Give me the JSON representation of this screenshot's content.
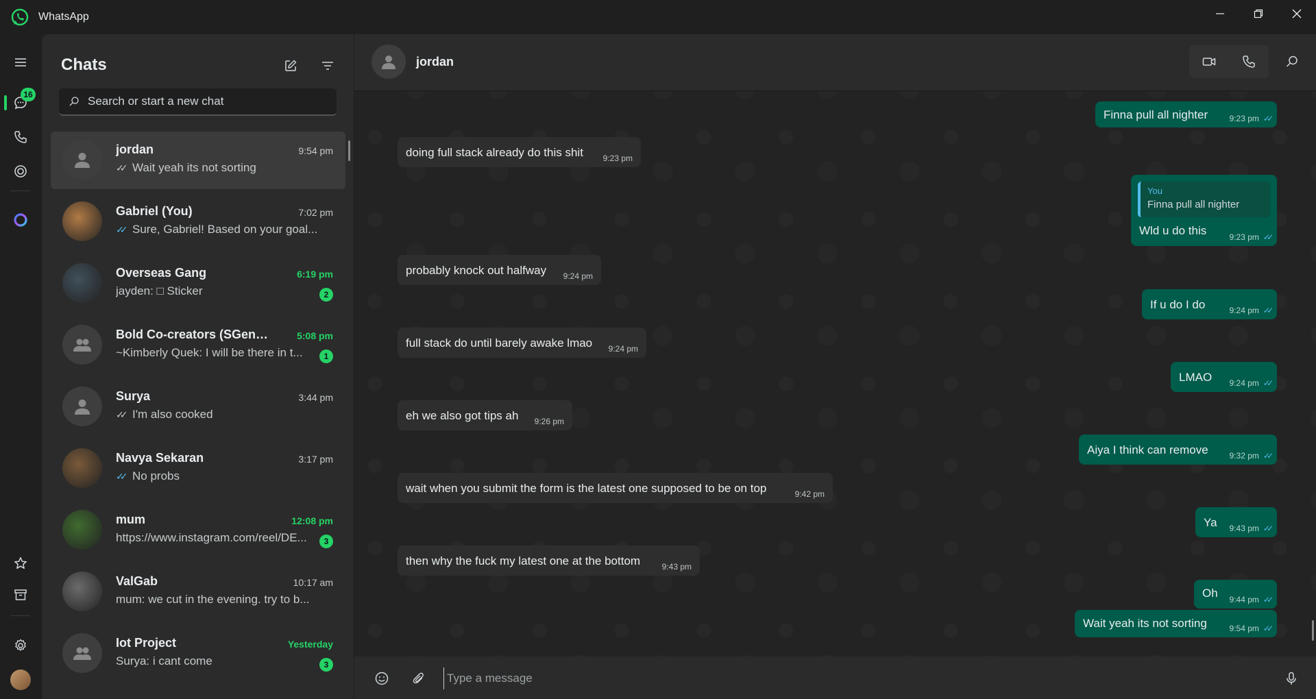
{
  "app": {
    "title": "WhatsApp"
  },
  "rail": {
    "chats_unread": "16"
  },
  "chatlist": {
    "title": "Chats",
    "search_placeholder": "Search or start a new chat",
    "chats": [
      {
        "name": "jordan",
        "time": "9:54 pm",
        "time_unread": false,
        "tick": "grey",
        "preview": "Wait yeah its not sorting",
        "badge": ""
      },
      {
        "name": "Gabriel (You)",
        "time": "7:02 pm",
        "time_unread": false,
        "tick": "read",
        "preview": "Sure, Gabriel! Based on your goal...",
        "badge": ""
      },
      {
        "name": "Overseas Gang",
        "time": "6:19 pm",
        "time_unread": true,
        "tick": "",
        "preview": "jayden: □ Sticker",
        "badge": "2"
      },
      {
        "name": "Bold Co-creators (SGenable...",
        "time": "5:08 pm",
        "time_unread": true,
        "tick": "",
        "preview": "~Kimberly Quek: I will be there in t...",
        "badge": "1"
      },
      {
        "name": "Surya",
        "time": "3:44 pm",
        "time_unread": false,
        "tick": "grey",
        "preview": "I'm also cooked",
        "badge": ""
      },
      {
        "name": "Navya Sekaran",
        "time": "3:17 pm",
        "time_unread": false,
        "tick": "read",
        "preview": "No probs",
        "badge": ""
      },
      {
        "name": "mum",
        "time": "12:08 pm",
        "time_unread": true,
        "tick": "",
        "preview": "https://www.instagram.com/reel/DE...",
        "badge": "3"
      },
      {
        "name": "ValGab",
        "time": "10:17 am",
        "time_unread": false,
        "tick": "",
        "preview": "mum: we cut in the evening. try to b...",
        "badge": ""
      },
      {
        "name": "Iot Project",
        "time": "Yesterday",
        "time_unread": true,
        "tick": "",
        "preview": "Surya: i cant come",
        "badge": "3"
      }
    ]
  },
  "conversation": {
    "contact_name": "jordan",
    "messages": [
      {
        "dir": "out",
        "text": "Finna pull all nighter",
        "time": "9:23 pm"
      },
      {
        "dir": "in",
        "text": "doing full stack already do this shit",
        "time": "9:23 pm"
      },
      {
        "dir": "out",
        "text": "Wld u do this",
        "time": "9:23 pm",
        "quote_author": "You",
        "quote_text": "Finna pull all nighter"
      },
      {
        "dir": "in",
        "text": "probably knock out halfway",
        "time": "9:24 pm"
      },
      {
        "dir": "out",
        "text": "If u do I do",
        "time": "9:24 pm"
      },
      {
        "dir": "in",
        "text": "full stack do until barely awake lmao",
        "time": "9:24 pm"
      },
      {
        "dir": "out",
        "text": "LMAO",
        "time": "9:24 pm"
      },
      {
        "dir": "in",
        "text": "eh we also got tips ah",
        "time": "9:26 pm"
      },
      {
        "dir": "out",
        "text": "Aiya I think can remove",
        "time": "9:32 pm"
      },
      {
        "dir": "in",
        "text": "wait when you submit the form is the latest one supposed to be on top",
        "time": "9:42 pm"
      },
      {
        "dir": "out",
        "text": "Ya",
        "time": "9:43 pm"
      },
      {
        "dir": "in",
        "text": "then why the fuck my latest one at the bottom",
        "time": "9:43 pm"
      },
      {
        "dir": "out",
        "text": "Oh",
        "time": "9:44 pm"
      },
      {
        "dir": "out",
        "text": "Wait yeah its not sorting",
        "time": "9:54 pm"
      }
    ]
  },
  "composer": {
    "placeholder": "Type a message"
  },
  "colors": {
    "accent": "#25d366",
    "outgoing_bubble": "#005c4b",
    "incoming_bubble": "#2e2e2e",
    "read_tick": "#53bdeb"
  }
}
